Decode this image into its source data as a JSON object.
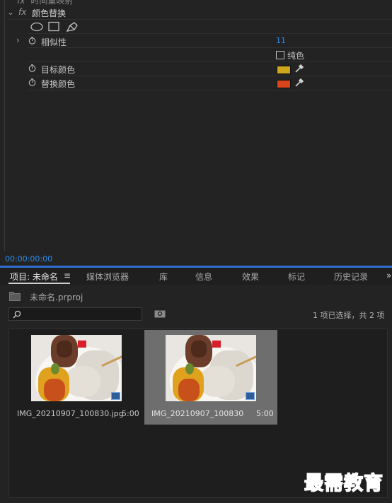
{
  "effects": {
    "clipped_label": "时间重映射",
    "fx_label": "fx",
    "effect_name": "颜色替换",
    "param_similarity": {
      "label": "相似性",
      "value": "11"
    },
    "param_solid": {
      "label": "纯色"
    },
    "param_target_color": {
      "label": "目标颜色",
      "color": "#d0a71a"
    },
    "param_replace_color": {
      "label": "替换颜色",
      "color": "#d9461c"
    },
    "timecode": "00:00:00:00"
  },
  "project": {
    "tabs": [
      {
        "label": "项目: 未命名"
      },
      {
        "label": "媒体浏览器"
      },
      {
        "label": "库"
      },
      {
        "label": "信息"
      },
      {
        "label": "效果"
      },
      {
        "label": "标记"
      },
      {
        "label": "历史记录"
      }
    ],
    "file_name": "未命名.prproj",
    "selection_status": "1 项已选择，共 2 项",
    "items": [
      {
        "name": "IMG_20210907_100830.jpg",
        "duration": "5:00"
      },
      {
        "name": "IMG_20210907_100830",
        "duration": "5:00"
      }
    ]
  },
  "watermark": "最需教育",
  "colors": {
    "accent": "#2d8ceb",
    "divider": "#2f6fcc",
    "selected_card": "#6e6e6e"
  }
}
